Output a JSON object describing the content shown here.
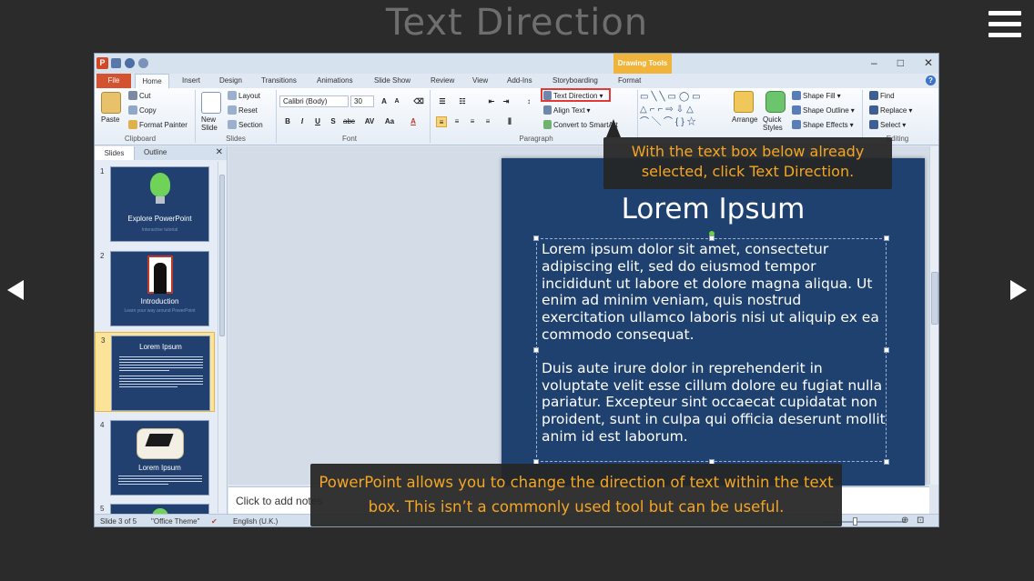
{
  "page": {
    "title": "Text Direction"
  },
  "window": {
    "drawing_tools": "Drawing Tools",
    "tabs": [
      "Home",
      "Insert",
      "Design",
      "Transitions",
      "Animations",
      "Slide Show",
      "Review",
      "View",
      "Add-Ins",
      "Storyboarding"
    ],
    "file_tab": "File",
    "format_tab": "Format",
    "controls": {
      "minimize": "–",
      "maximize": "□",
      "close": "✕"
    }
  },
  "ribbon": {
    "clipboard": {
      "label": "Clipboard",
      "paste": "Paste",
      "cut": "Cut",
      "copy": "Copy",
      "format_painter": "Format Painter"
    },
    "slides": {
      "label": "Slides",
      "new_slide": "New Slide",
      "layout": "Layout",
      "reset": "Reset",
      "section": "Section"
    },
    "font": {
      "label": "Font",
      "name": "Calibri (Body)",
      "size": "30"
    },
    "paragraph": {
      "label": "Paragraph",
      "text_direction": "Text Direction",
      "align_text": "Align Text",
      "convert_smartart": "Convert to SmartArt"
    },
    "drawing": {
      "arrange": "Arrange",
      "quick_styles": "Quick Styles",
      "shape_fill": "Shape Fill",
      "shape_outline": "Shape Outline",
      "shape_effects": "Shape Effects"
    },
    "editing": {
      "label": "Editing",
      "find": "Find",
      "replace": "Replace",
      "select": "Select"
    }
  },
  "left_panel": {
    "tabs": {
      "slides": "Slides",
      "outline": "Outline"
    },
    "thumbnails": [
      {
        "num": "1",
        "title": "Explore PowerPoint",
        "sub": "Interactive tutorial"
      },
      {
        "num": "2",
        "title": "Introduction",
        "sub": "Learn your way around PowerPoint"
      },
      {
        "num": "3",
        "title": "Lorem Ipsum"
      },
      {
        "num": "4",
        "title": "Lorem Ipsum"
      },
      {
        "num": "5"
      }
    ]
  },
  "slide": {
    "title": "Lorem Ipsum",
    "para1": "Lorem ipsum dolor sit amet, consectetur adipiscing elit, sed do eiusmod tempor incididunt ut labore et dolore magna aliqua. Ut enim ad minim veniam, quis nostrud exercitation ullamco laboris nisi ut aliquip ex ea commodo consequat.",
    "para2": "Duis aute irure dolor in reprehenderit in voluptate velit esse cillum dolore eu fugiat nulla pariatur. Excepteur sint occaecat cupidatat non proident, sunt in culpa qui officia deserunt mollit anim id est laborum."
  },
  "notes": {
    "placeholder": "Click to add notes"
  },
  "status": {
    "slide": "Slide 3 of 5",
    "theme": "\"Office Theme\"",
    "language": "English (U.K.)"
  },
  "callouts": {
    "top": "With the text box below already selected, click Text Direction.",
    "bottom": "PowerPoint allows you to change the direction of text within the text box. This isn’t a commonly used tool but can be useful."
  }
}
